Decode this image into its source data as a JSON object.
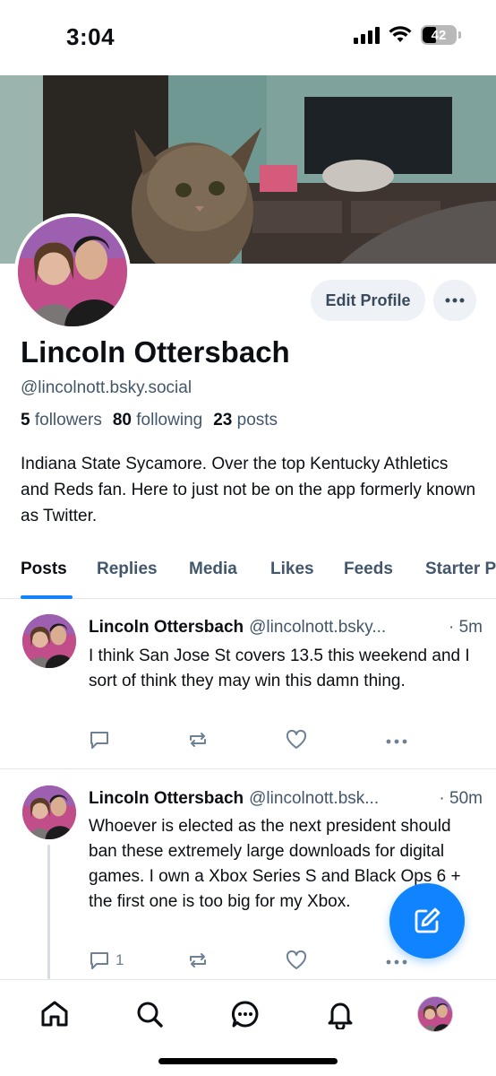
{
  "status_bar": {
    "time": "3:04",
    "battery": "42"
  },
  "profile": {
    "name": "Lincoln Ottersbach",
    "handle": "@lincolnott.bsky.social",
    "followers_count": "5",
    "followers_label": "followers",
    "following_count": "80",
    "following_label": "following",
    "posts_count": "23",
    "posts_label": "posts",
    "bio": "Indiana State Sycamore. Over the top Kentucky Athletics and Reds fan. Here to just not be on the app formerly known as Twitter.",
    "edit_profile_label": "Edit Profile"
  },
  "tabs": [
    {
      "label": "Posts",
      "active": true
    },
    {
      "label": "Replies"
    },
    {
      "label": "Media"
    },
    {
      "label": "Likes"
    },
    {
      "label": "Feeds"
    },
    {
      "label": "Starter P"
    }
  ],
  "posts": [
    {
      "author": "Lincoln Ottersbach",
      "handle": "@lincolnott.bsky...",
      "time": "· 5m",
      "text": "I think San Jose St covers 13.5 this weekend and I sort of think they may win this damn thing.",
      "reply_count": "",
      "repost_count": "",
      "like_count": ""
    },
    {
      "author": "Lincoln Ottersbach",
      "handle": "@lincolnott.bsk...",
      "time": "· 50m",
      "text": "Whoever is elected as the next president should ban these extremely large downloads for digital games. I own a Xbox Series S and Black Ops 6 + the first one is too big for my Xbox.",
      "reply_count": "1",
      "repost_count": "",
      "like_count": ""
    }
  ],
  "colors": {
    "accent": "#1083fe",
    "muted": "#42576c",
    "text": "#0b0f14"
  },
  "nav": [
    "home-icon",
    "search-icon",
    "chat-icon",
    "bell-icon",
    "profile-avatar"
  ]
}
